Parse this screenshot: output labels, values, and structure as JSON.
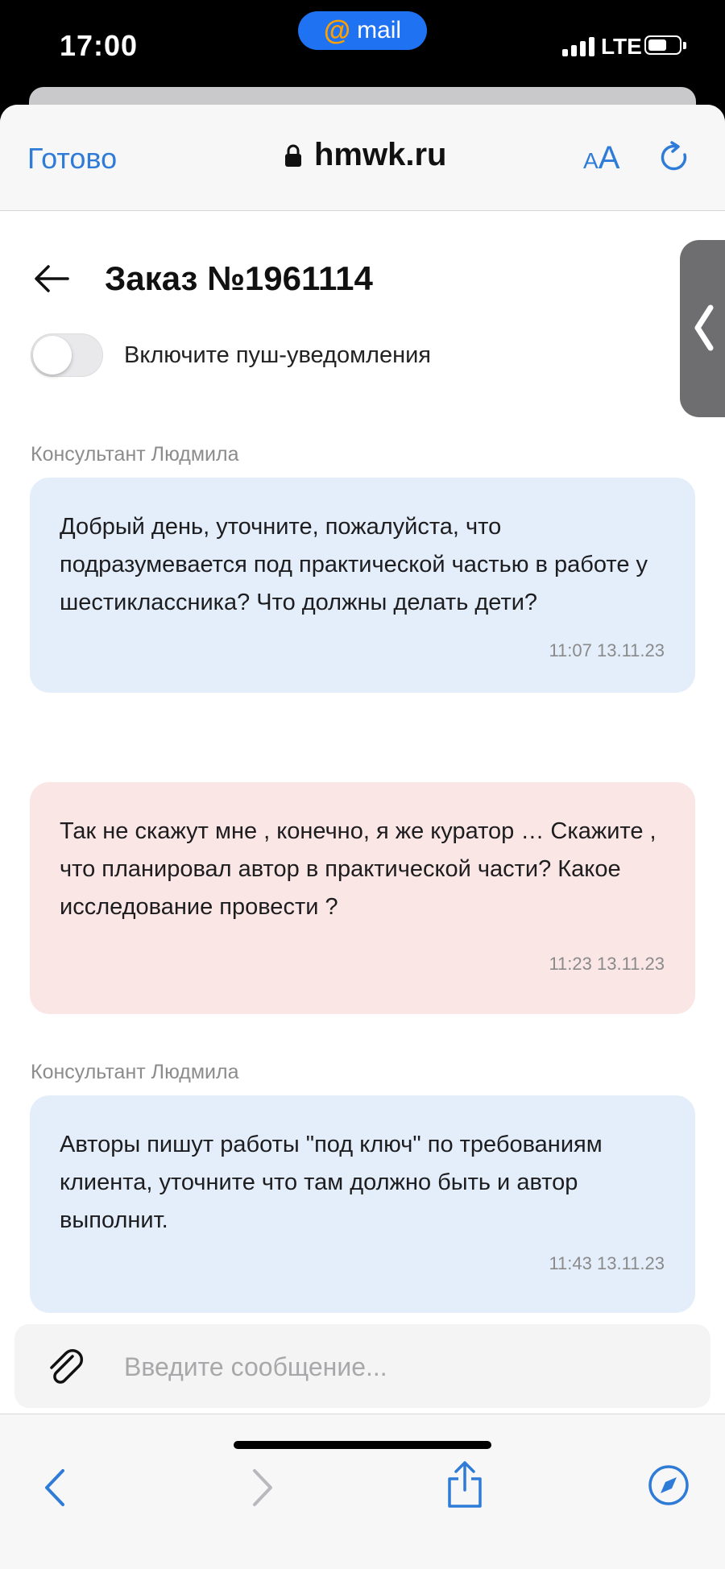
{
  "status_bar": {
    "time": "17:00",
    "carrier_pill": "mail",
    "network": "LTE"
  },
  "browser": {
    "done_label": "Готово",
    "url": "hmwk.ru",
    "text_size_small": "A",
    "text_size_big": "A"
  },
  "page": {
    "title": "Заказ №1961114",
    "push_toggle_label": "Включите пуш-уведомления",
    "push_enabled": false
  },
  "messages": [
    {
      "sender": "Консультант Людмила",
      "text": "Добрый день, уточните, пожалуйста, что подразумевается под практической частью в работе у шестиклассника? Что должны делать дети?",
      "timestamp": "11:07 13.11.23",
      "color": "#e4eefb"
    },
    {
      "sender": "",
      "text": "Так не скажут мне , конечно, я же куратор … Скажите , что планировал автор в практической части? Какое исследование провести ?",
      "timestamp": "11:23 13.11.23",
      "color": "#fbe6e6"
    },
    {
      "sender": "Консультант Людмила",
      "text": "Авторы пишут работы \"под ключ\" по требованиям клиента, уточните что там должно быть и автор выполнит.",
      "timestamp": "11:43 13.11.23",
      "color": "#e4eefb"
    }
  ],
  "composer": {
    "placeholder": "Введите сообщение..."
  },
  "colors": {
    "accent": "#2f7bd8",
    "consultant_bubble": "#e4eefb",
    "client_bubble": "#fbe6e6"
  }
}
